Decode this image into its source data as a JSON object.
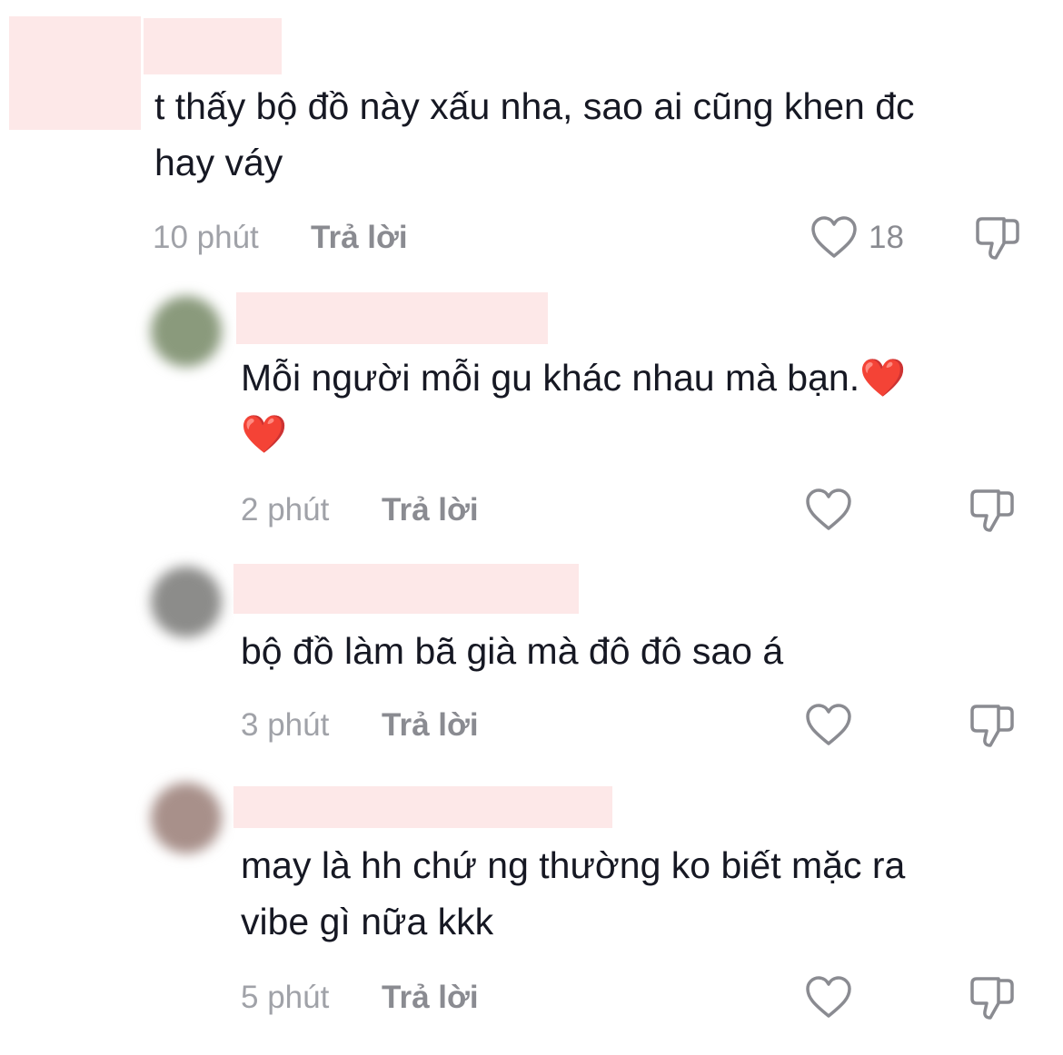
{
  "comments": [
    {
      "text": "t thấy bộ đồ này xấu nha, sao ai cũng khen đc\nhay váy",
      "time": "10 phút",
      "reply_label": "Trả lời",
      "likes": "18"
    },
    {
      "text": "Mỗi người mỗi gu khác nhau mà bạn.❤️\n❤️",
      "time": "2 phút",
      "reply_label": "Trả lời",
      "likes": ""
    },
    {
      "text": "bộ đồ làm bã già mà đô đô sao á",
      "time": "3 phút",
      "reply_label": "Trả lời",
      "likes": ""
    },
    {
      "text": "may là hh chứ ng thường ko biết mặc ra\nvibe gì nữa kkk",
      "time": "5 phút",
      "reply_label": "Trả lời",
      "likes": ""
    }
  ],
  "icons": {
    "like": "heart-outline-icon",
    "dislike": "thumbs-down-outline-icon"
  },
  "colors": {
    "redaction": "#fde8e8",
    "text": "#161823",
    "muted": "#a0a2a8",
    "icon": "#8a8b91"
  }
}
